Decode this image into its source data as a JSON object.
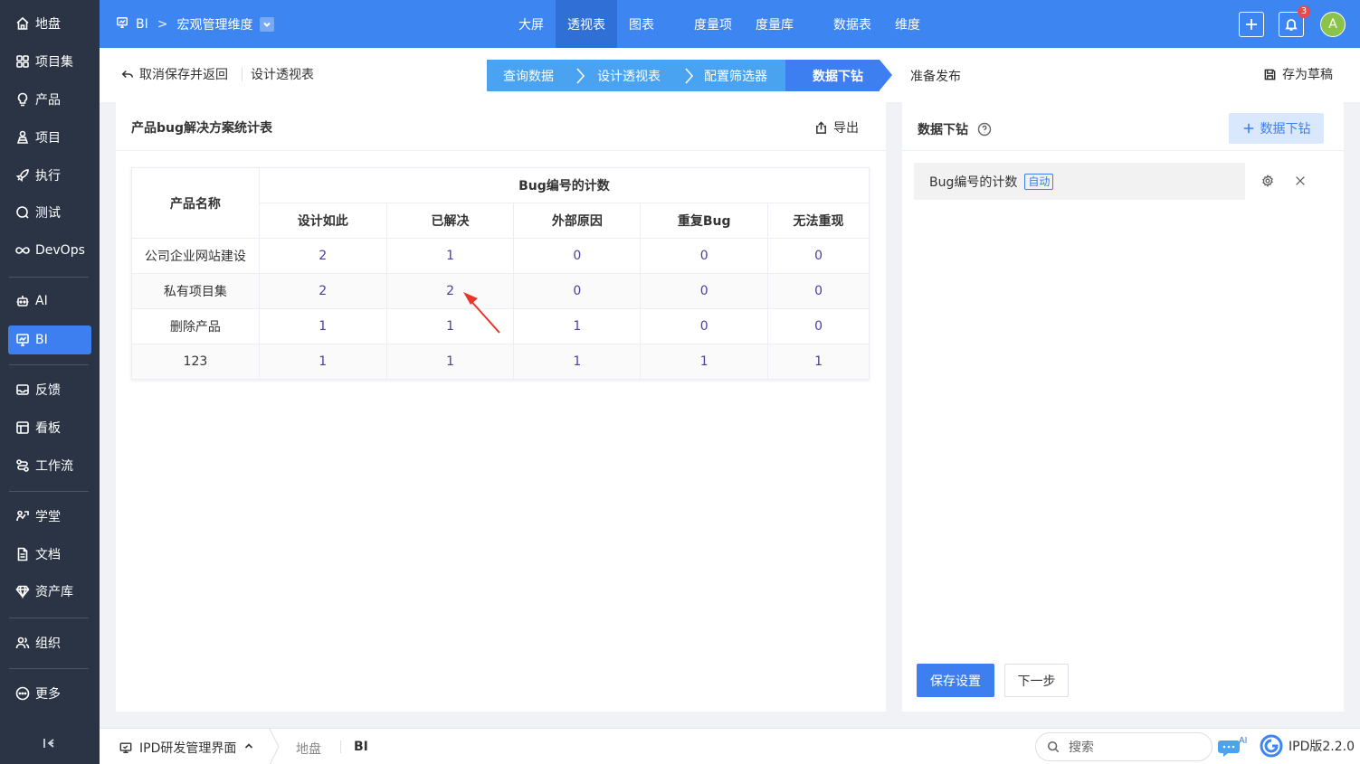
{
  "sidebar": {
    "items": [
      {
        "label": "地盘",
        "icon": "home-icon"
      },
      {
        "label": "项目集",
        "icon": "grid-icon"
      },
      {
        "label": "产品",
        "icon": "lightbulb-icon"
      },
      {
        "label": "项目",
        "icon": "person-stack-icon"
      },
      {
        "label": "执行",
        "icon": "rocket-icon"
      },
      {
        "label": "测试",
        "icon": "search-circle-icon"
      },
      {
        "label": "DevOps",
        "icon": "infinity-icon"
      },
      {
        "label": "AI",
        "icon": "robot-icon"
      },
      {
        "label": "BI",
        "icon": "chart-board-icon"
      },
      {
        "label": "反馈",
        "icon": "feedback-icon"
      },
      {
        "label": "看板",
        "icon": "kanban-icon"
      },
      {
        "label": "工作流",
        "icon": "workflow-icon"
      },
      {
        "label": "学堂",
        "icon": "school-icon"
      },
      {
        "label": "文档",
        "icon": "document-icon"
      },
      {
        "label": "资产库",
        "icon": "diamond-icon"
      },
      {
        "label": "组织",
        "icon": "people-icon"
      },
      {
        "label": "更多",
        "icon": "more-icon"
      }
    ],
    "active": "BI"
  },
  "topbar": {
    "module": "BI",
    "separator": ">",
    "dimension": "宏观管理维度",
    "nav": [
      "大屏",
      "透视表",
      "图表",
      "度量项",
      "度量库",
      "数据表",
      "维度"
    ],
    "active_nav": "透视表",
    "notification_count": "3",
    "avatar_letter": "A"
  },
  "subbar": {
    "back_label": "取消保存并返回",
    "design_label": "设计透视表",
    "steps": [
      "查询数据",
      "设计透视表",
      "配置筛选器",
      "数据下钻",
      "准备发布"
    ],
    "active_step": "数据下钻",
    "draft_label": "存为草稿"
  },
  "pivot": {
    "title": "产品bug解决方案统计表",
    "export_label": "导出",
    "row_header": "产品名称",
    "group_header": "Bug编号的计数",
    "columns": [
      "设计如此",
      "已解决",
      "外部原因",
      "重复Bug",
      "无法重现"
    ],
    "rows": [
      {
        "name": "公司企业网站建设",
        "values": [
          "2",
          "1",
          "0",
          "0",
          "0"
        ]
      },
      {
        "name": "私有项目集",
        "values": [
          "2",
          "2",
          "0",
          "0",
          "0"
        ]
      },
      {
        "name": "删除产品",
        "values": [
          "1",
          "1",
          "1",
          "0",
          "0"
        ]
      },
      {
        "name": "123",
        "values": [
          "1",
          "1",
          "1",
          "1",
          "1"
        ]
      }
    ]
  },
  "drill": {
    "title": "数据下钻",
    "add_label": "数据下钻",
    "field_name": "Bug编号的计数",
    "field_tag": "自动",
    "save_label": "保存设置",
    "next_label": "下一步"
  },
  "bottombar": {
    "workspace": "IPD研发管理界面",
    "crumb1": "地盘",
    "crumb2": "BI",
    "search_placeholder": "搜索",
    "chat_badge": "AI",
    "version": "IPD版2.2.0"
  },
  "colors": {
    "primary": "#3d85f0",
    "sidebar": "#2b3445",
    "step": "#4aa3f0",
    "active_step": "#3d7ff0",
    "annotation_arrow": "#e8362a"
  }
}
